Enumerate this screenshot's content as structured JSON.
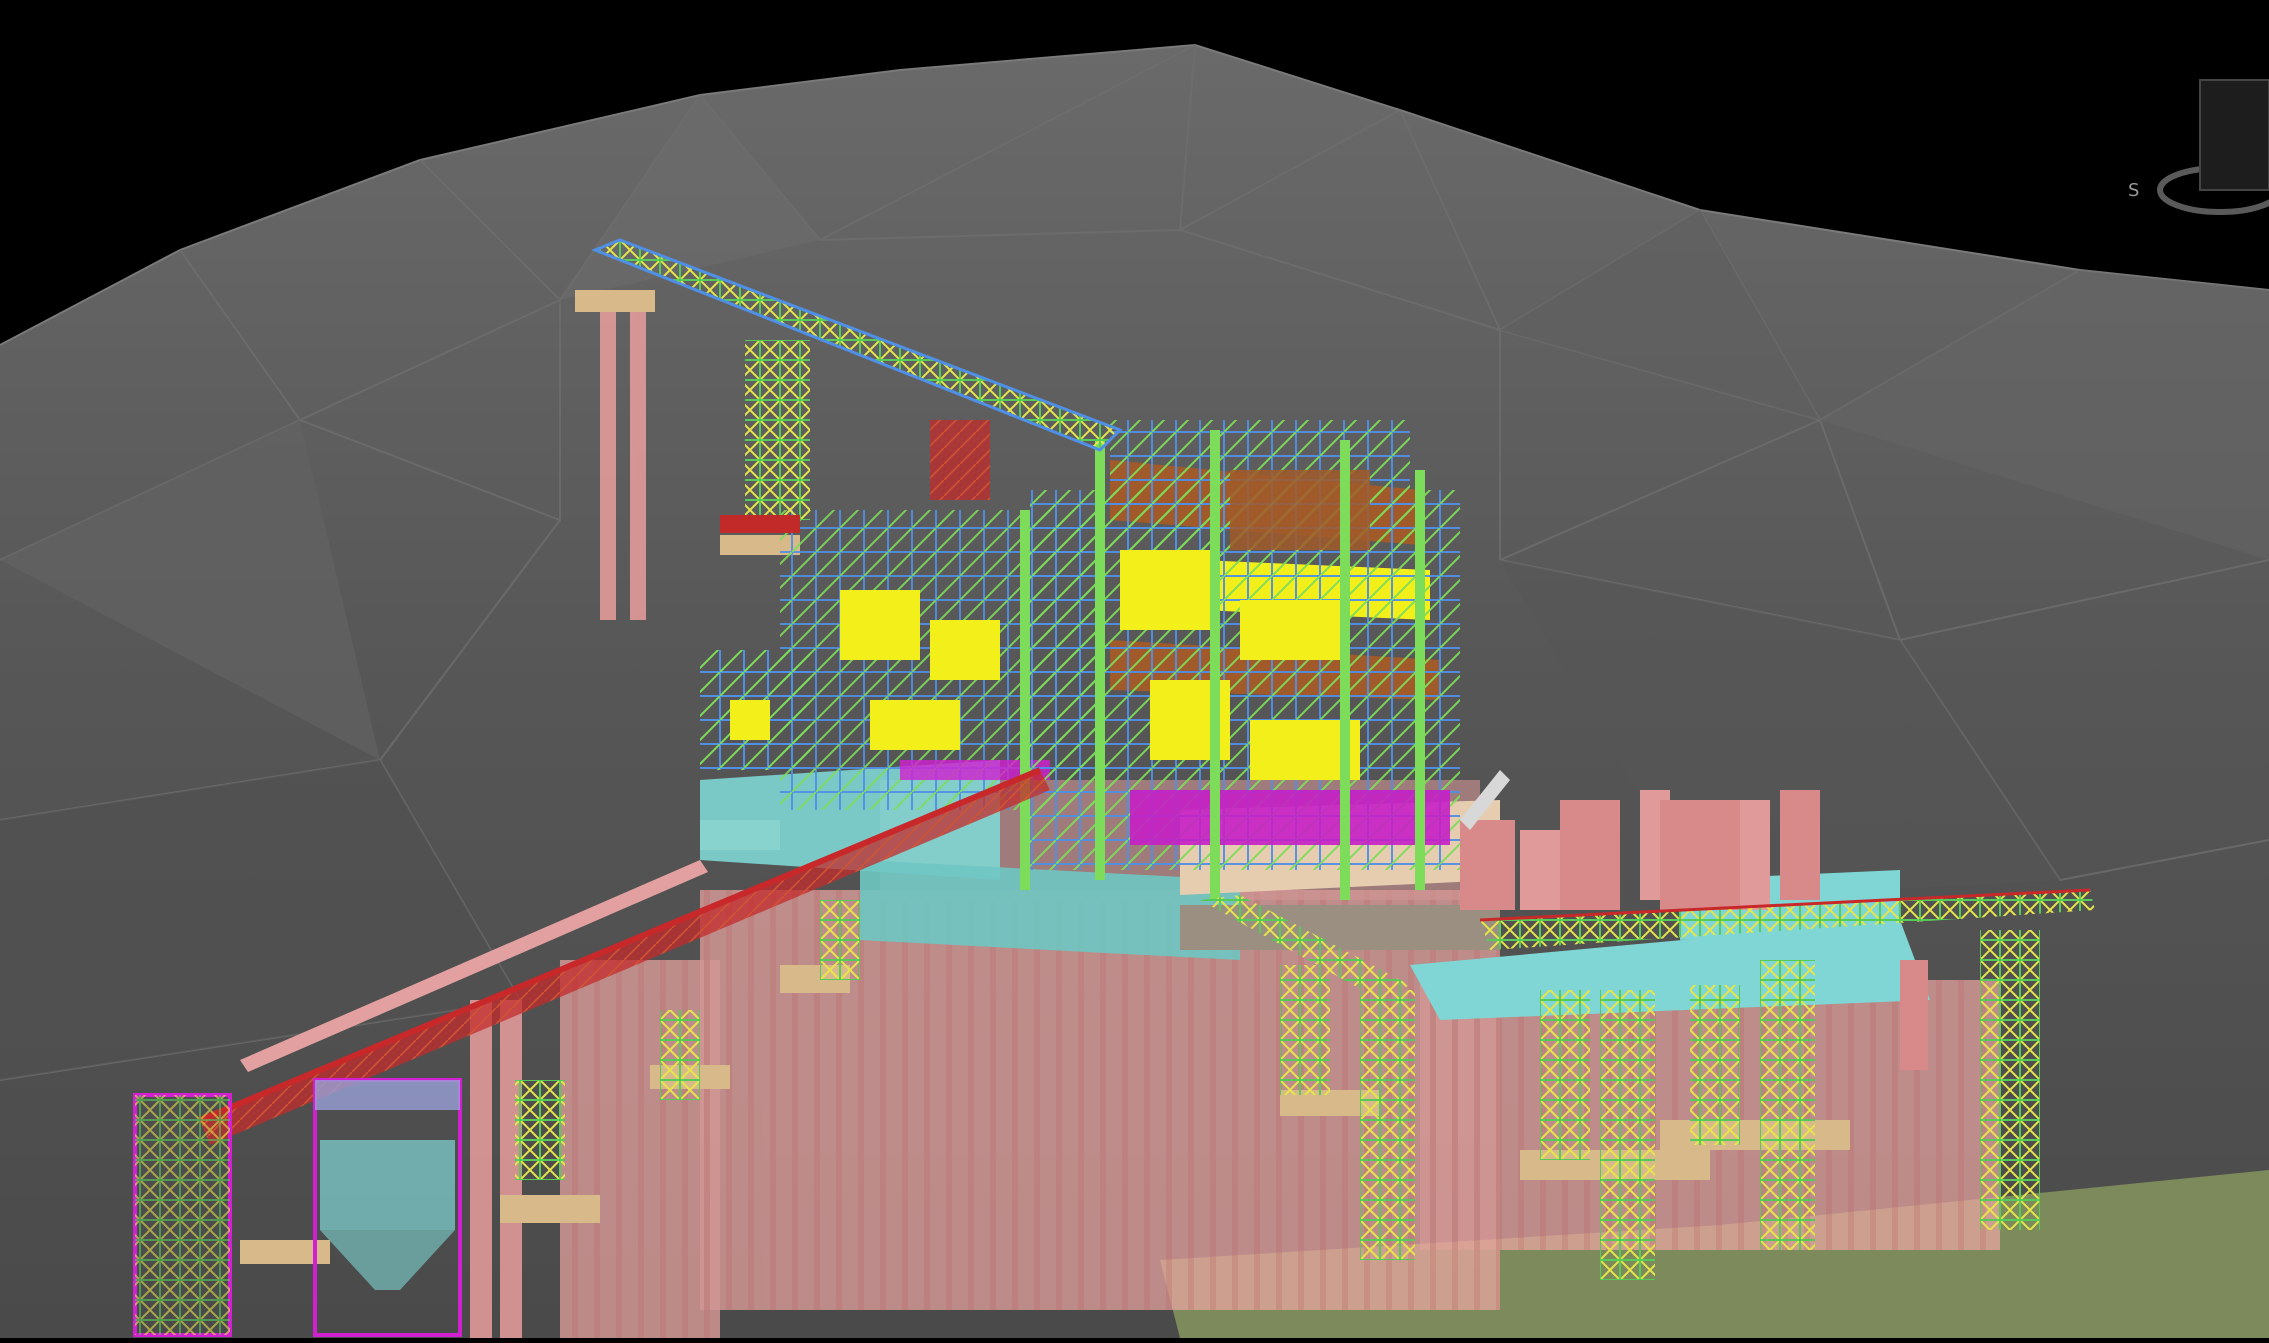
{
  "viewport": {
    "background_color": "#000000",
    "terrain_color": "#5a5a5a",
    "ground_patch_color": "#7d8a5b",
    "structure_palette": {
      "frame_green": "#7ddc5a",
      "frame_blue": "#4f8fe6",
      "equipment_yellow": "#f2ef1a",
      "floor_brown": "#a15a2a",
      "conveyor_red": "#c8282a",
      "bracing_magenta": "#d21fd2",
      "piles_pink": "#f4a3a3",
      "slab_cyan": "#7fd6d4",
      "pile_cap_tan": "#d8b98a",
      "tower_yellow": "#e6e64a"
    }
  },
  "viewcube": {
    "icon": "view-cube-icon",
    "compass_label": "S"
  }
}
